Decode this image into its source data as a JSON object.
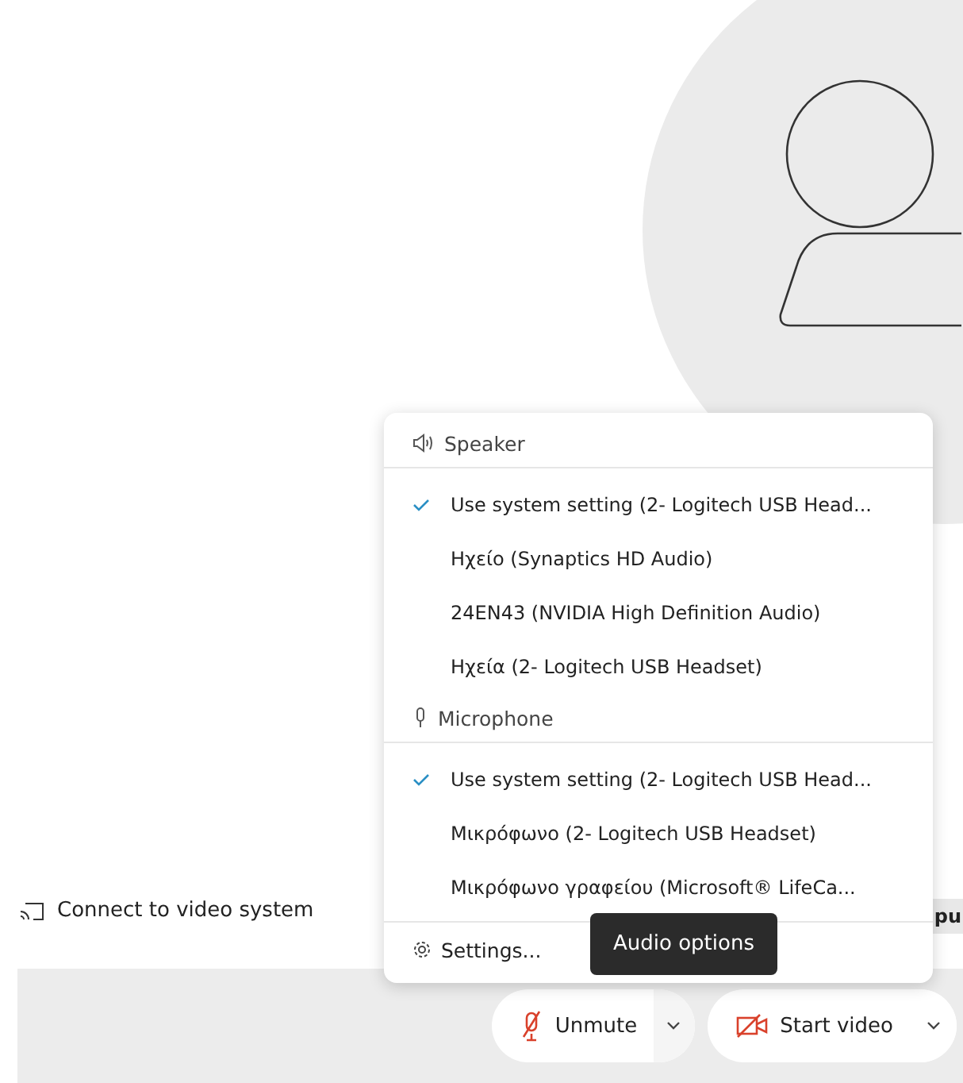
{
  "connect_link": {
    "label": "Connect to video system"
  },
  "background_banner": {
    "text": "pu"
  },
  "audio_menu": {
    "sections": [
      {
        "kind": "speaker",
        "title": "Speaker",
        "options": [
          {
            "label": "Use system setting (2- Logitech USB Head...",
            "selected": true
          },
          {
            "label": "Ηχείο (Synaptics HD Audio)",
            "selected": false
          },
          {
            "label": "24EN43 (NVIDIA High Definition Audio)",
            "selected": false
          },
          {
            "label": "Ηχεία (2- Logitech USB Headset)",
            "selected": false
          }
        ]
      },
      {
        "kind": "microphone",
        "title": "Microphone",
        "options": [
          {
            "label": "Use system setting (2- Logitech USB Head...",
            "selected": true
          },
          {
            "label": "Μικρόφωνο (2- Logitech USB Headset)",
            "selected": false
          },
          {
            "label": "Μικρόφωνο γραφείου (Microsoft® LifeCa...",
            "selected": false
          }
        ]
      }
    ],
    "settings": "Settings..."
  },
  "tooltip": "Audio options",
  "controls": [
    {
      "kind": "mic",
      "label": "Unmute"
    },
    {
      "kind": "video",
      "label": "Start video"
    }
  ]
}
